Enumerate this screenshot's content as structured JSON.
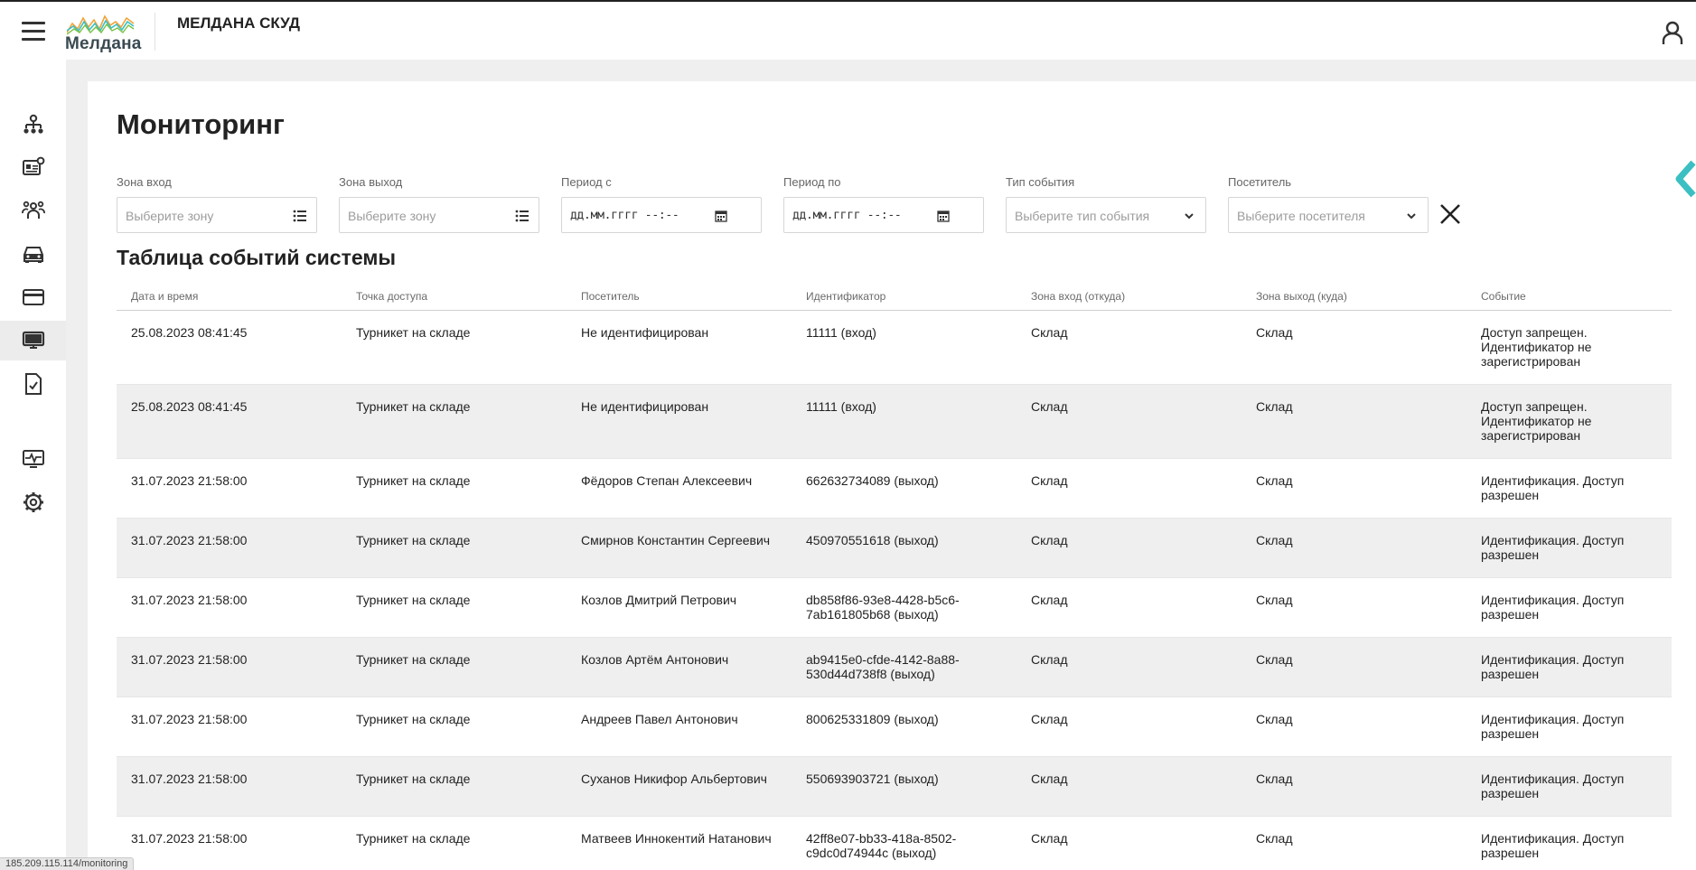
{
  "header": {
    "logo_text": "Мелдана",
    "app_title": "МЕЛДАНА СКУД"
  },
  "sidebar": {
    "items": [
      {
        "icon": "hierarchy-icon",
        "active": false
      },
      {
        "icon": "id-card-gear-icon",
        "active": false
      },
      {
        "icon": "people-group-icon",
        "active": false
      },
      {
        "icon": "car-icon",
        "active": false
      },
      {
        "icon": "credit-card-icon",
        "active": false
      },
      {
        "icon": "monitor-icon",
        "active": true
      },
      {
        "icon": "document-check-icon",
        "active": false
      },
      {
        "icon": "monitor-pulse-icon",
        "active": false
      },
      {
        "icon": "settings-gear-icon",
        "active": false
      }
    ]
  },
  "page": {
    "title": "Мониторинг"
  },
  "filters": {
    "zone_in": {
      "label": "Зона вход",
      "placeholder": "Выберите зону"
    },
    "zone_out": {
      "label": "Зона выход",
      "placeholder": "Выберите зону"
    },
    "period_from": {
      "label": "Период с",
      "value": "дд.мм.гггг --:--"
    },
    "period_to": {
      "label": "Период по",
      "value": "дд.мм.гггг --:--"
    },
    "event_type": {
      "label": "Тип события",
      "placeholder": "Выберите тип события"
    },
    "visitor": {
      "label": "Посетитель",
      "placeholder": "Выберите посетителя"
    }
  },
  "table": {
    "title": "Таблица событий системы",
    "columns": [
      "Дата и время",
      "Точка доступа",
      "Посетитель",
      "Идентификатор",
      "Зона вход (откуда)",
      "Зона выход (куда)",
      "Событие"
    ],
    "rows": [
      [
        "25.08.2023 08:41:45",
        "Турникет на складе",
        "Не идентифицирован",
        "11111 (вход)",
        "Склад",
        "Склад",
        "Доступ запрещен. Идентификатор не зарегистрирован"
      ],
      [
        "25.08.2023 08:41:45",
        "Турникет на складе",
        "Не идентифицирован",
        "11111 (вход)",
        "Склад",
        "Склад",
        "Доступ запрещен. Идентификатор не зарегистрирован"
      ],
      [
        "31.07.2023 21:58:00",
        "Турникет на складе",
        "Фёдоров Степан Алексеевич",
        "662632734089 (выход)",
        "Склад",
        "Склад",
        "Идентификация. Доступ разрешен"
      ],
      [
        "31.07.2023 21:58:00",
        "Турникет на складе",
        "Смирнов Константин Сергеевич",
        "450970551618 (выход)",
        "Склад",
        "Склад",
        "Идентификация. Доступ разрешен"
      ],
      [
        "31.07.2023 21:58:00",
        "Турникет на складе",
        "Козлов Дмитрий Петрович",
        "db858f86-93e8-4428-b5c6-7ab161805b68 (выход)",
        "Склад",
        "Склад",
        "Идентификация. Доступ разрешен"
      ],
      [
        "31.07.2023 21:58:00",
        "Турникет на складе",
        "Козлов Артём Антонович",
        "ab9415e0-cfde-4142-8a88-530d44d738f8 (выход)",
        "Склад",
        "Склад",
        "Идентификация. Доступ разрешен"
      ],
      [
        "31.07.2023 21:58:00",
        "Турникет на складе",
        "Андреев Павел Антонович",
        "800625331809 (выход)",
        "Склад",
        "Склад",
        "Идентификация. Доступ разрешен"
      ],
      [
        "31.07.2023 21:58:00",
        "Турникет на складе",
        "Суханов Никифор Альбертович",
        "550693903721 (выход)",
        "Склад",
        "Склад",
        "Идентификация. Доступ разрешен"
      ],
      [
        "31.07.2023 21:58:00",
        "Турникет на складе",
        "Матвеев Иннокентий Натанович",
        "42ff8e07-bb33-418a-8502-c9dc0d74944c (выход)",
        "Склад",
        "Склад",
        "Идентификация. Доступ разрешен"
      ]
    ]
  },
  "status_bar": {
    "url": "185.209.115.114/monitoring"
  },
  "colors": {
    "accent": "#3bbfc2",
    "row_alt": "#efefef",
    "content_bg": "#efefef"
  }
}
